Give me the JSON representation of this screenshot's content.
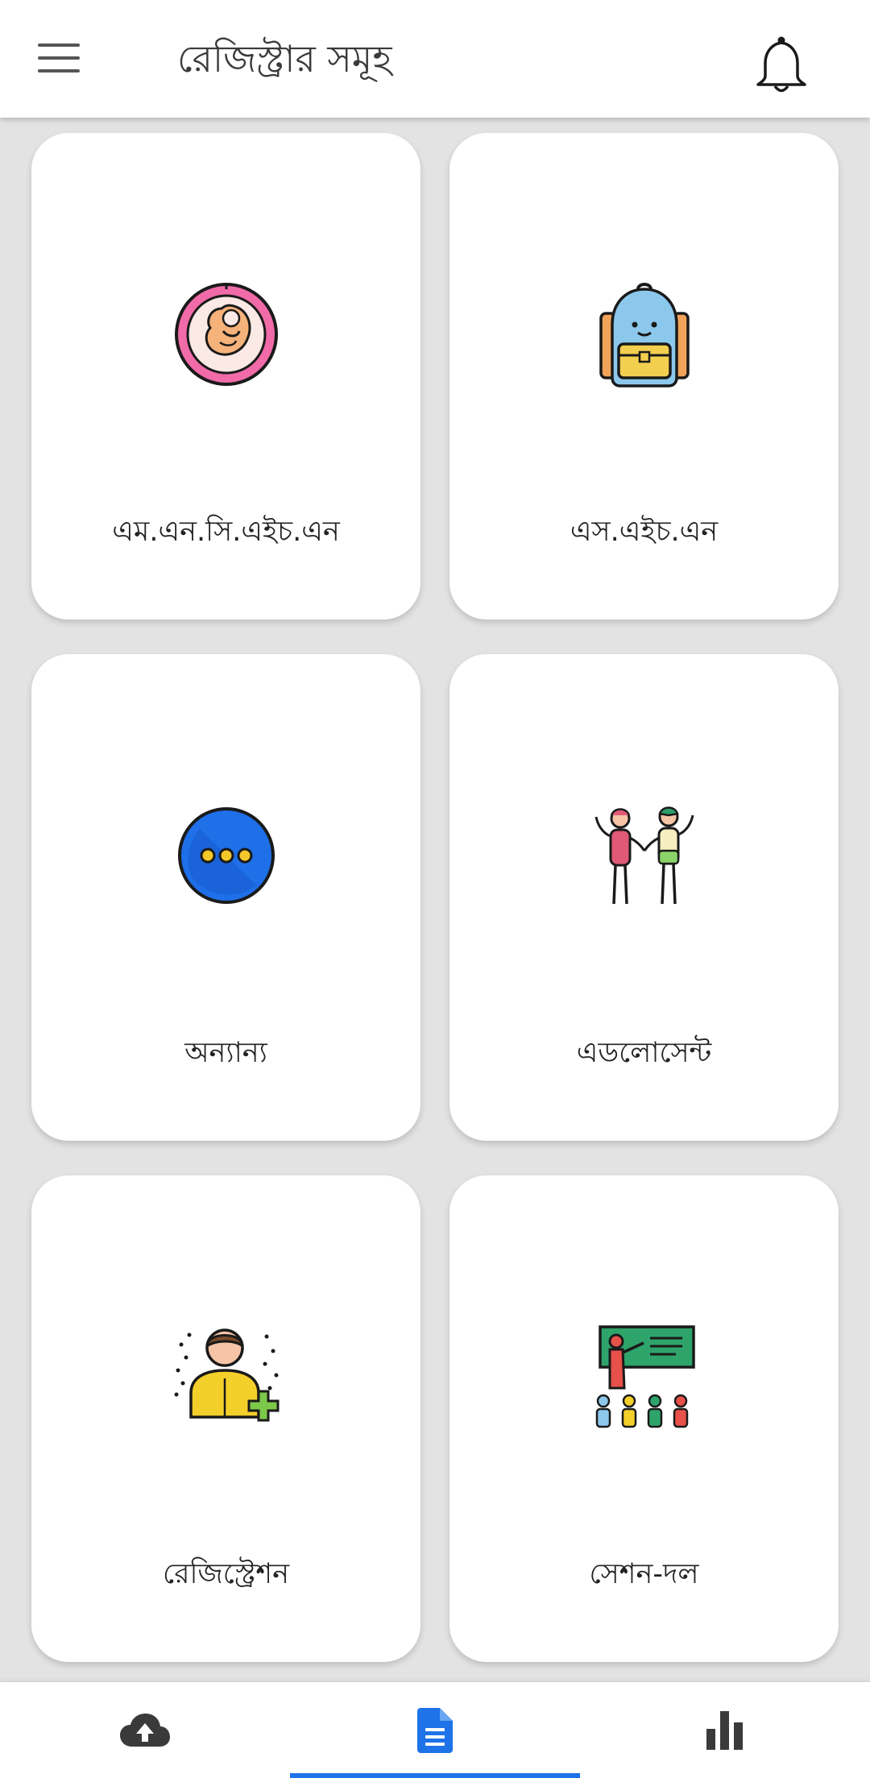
{
  "header": {
    "title": "রেজিস্ট্রার সমূহ",
    "menu_icon": "hamburger-menu-icon",
    "notification_icon": "bell-icon"
  },
  "cards": [
    {
      "label": "এম.এন.সি.এইচ.এন",
      "icon": "fetus-icon"
    },
    {
      "label": "এস.এইচ.এন",
      "icon": "school-bag-icon"
    },
    {
      "label": "অন্যান্য",
      "icon": "more-dots-icon"
    },
    {
      "label": "এডলোসেন্ট",
      "icon": "adolescents-icon"
    },
    {
      "label": "রেজিস্ট্রেশন",
      "icon": "add-user-icon"
    },
    {
      "label": "সেশন-দল",
      "icon": "classroom-session-icon"
    }
  ],
  "bottom_nav": {
    "items": [
      {
        "icon": "cloud-upload-icon",
        "active": false
      },
      {
        "icon": "document-icon",
        "active": true
      },
      {
        "icon": "bar-chart-icon",
        "active": false
      }
    ],
    "active_color": "#1e73e8",
    "inactive_color": "#3a3a3a"
  }
}
